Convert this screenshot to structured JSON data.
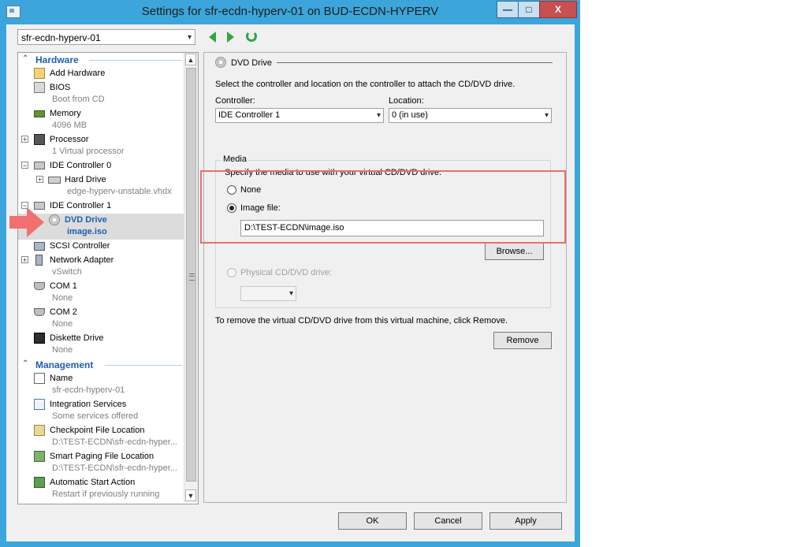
{
  "window": {
    "title": "Settings for sfr-ecdn-hyperv-01 on BUD-ECDN-HYPERV",
    "controls": {
      "minimize": "—",
      "maximize": "□",
      "close": "X"
    }
  },
  "toolbar": {
    "vm_selected": "sfr-ecdn-hyperv-01",
    "back_icon": "left-arrow",
    "forward_icon": "right-arrow",
    "refresh_icon": "refresh"
  },
  "tree": {
    "hardware_label": "Hardware",
    "management_label": "Management",
    "items": [
      {
        "name": "Add Hardware",
        "sub": ""
      },
      {
        "name": "BIOS",
        "sub": "Boot from CD"
      },
      {
        "name": "Memory",
        "sub": "4096 MB"
      },
      {
        "name": "Processor",
        "sub": "1 Virtual processor"
      },
      {
        "name": "IDE Controller 0",
        "sub": ""
      },
      {
        "name": "Hard Drive",
        "sub": "edge-hyperv-unstable.vhdx"
      },
      {
        "name": "IDE Controller 1",
        "sub": ""
      },
      {
        "name": "DVD Drive",
        "sub": "image.iso"
      },
      {
        "name": "SCSI Controller",
        "sub": ""
      },
      {
        "name": "Network Adapter",
        "sub": "vSwitch"
      },
      {
        "name": "COM 1",
        "sub": "None"
      },
      {
        "name": "COM 2",
        "sub": "None"
      },
      {
        "name": "Diskette Drive",
        "sub": "None"
      }
    ],
    "management_items": [
      {
        "name": "Name",
        "sub": "sfr-ecdn-hyperv-01"
      },
      {
        "name": "Integration Services",
        "sub": "Some services offered"
      },
      {
        "name": "Checkpoint File Location",
        "sub": "D:\\TEST-ECDN\\sfr-ecdn-hyper..."
      },
      {
        "name": "Smart Paging File Location",
        "sub": "D:\\TEST-ECDN\\sfr-ecdn-hyper..."
      },
      {
        "name": "Automatic Start Action",
        "sub": "Restart if previously running"
      }
    ]
  },
  "pane": {
    "section_title": "DVD Drive",
    "description": "Select the controller and location on the controller to attach the CD/DVD drive.",
    "controller_label": "Controller:",
    "controller_value": "IDE Controller 1",
    "location_label": "Location:",
    "location_value": "0 (in use)",
    "media_label": "Media",
    "media_description": "Specify the media to use with your virtual CD/DVD drive.",
    "none_label": "None",
    "image_file_label": "Image file:",
    "image_file_value": "D:\\TEST-ECDN\\image.iso",
    "browse_label": "Browse...",
    "physical_label": "Physical CD/DVD drive:",
    "physical_value": "",
    "remove_description": "To remove the virtual CD/DVD drive from this virtual machine, click Remove.",
    "remove_label": "Remove"
  },
  "footer": {
    "ok_label": "OK",
    "cancel_label": "Cancel",
    "apply_label": "Apply"
  },
  "colors": {
    "title_bar": "#3ba5dc",
    "accent_blue": "#1f5fb0",
    "highlight_red": "#ef6c6c",
    "nav_green": "#2ea844"
  }
}
